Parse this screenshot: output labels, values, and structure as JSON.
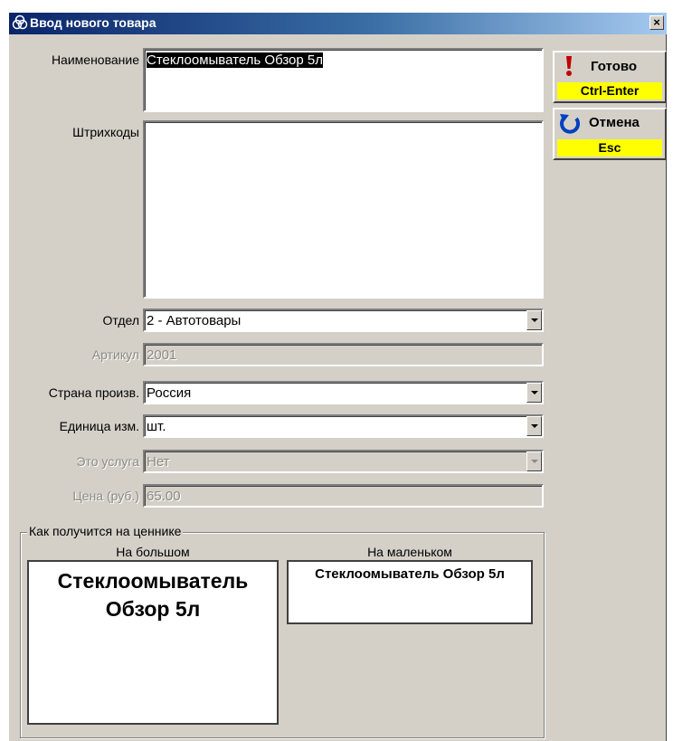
{
  "window": {
    "title": "Ввод нового товара",
    "close_glyph": "×"
  },
  "form": {
    "name": {
      "label": "Наименование",
      "value": "Стеклоомыватель  Обзор 5л"
    },
    "barcodes": {
      "label": "Штрихкоды",
      "value": ""
    },
    "department": {
      "label": "Отдел",
      "value": "2 - Автотовары"
    },
    "article": {
      "label": "Артикул",
      "value": "2001",
      "disabled": true
    },
    "country": {
      "label": "Страна произв.",
      "value": "Россия"
    },
    "unit": {
      "label": "Единица изм.",
      "value": "шт."
    },
    "is_service": {
      "label": "Это услуга",
      "value": "Нет",
      "disabled": true
    },
    "price": {
      "label": "Цена (руб.)",
      "value": "65.00",
      "disabled": true
    }
  },
  "buttons": {
    "done": {
      "label": "Готово",
      "shortcut": "Ctrl-Enter",
      "icon": "exclamation-icon"
    },
    "cancel": {
      "label": "Отмена",
      "shortcut": "Esc",
      "icon": "undo-arrow-icon"
    }
  },
  "preview": {
    "group_title": "Как получится на ценнике",
    "large": {
      "label": "На большом",
      "text": "Стеклоомыватель  Обзор 5л"
    },
    "small": {
      "label": "На маленьком",
      "text": "Стеклоомыватель  Обзор 5л"
    }
  },
  "colors": {
    "titlebar_start": "#0a246a",
    "titlebar_end": "#a6caf0",
    "window_bg": "#d4d0c8",
    "shortcut_bg": "#ffff00",
    "done_icon": "#c00000",
    "cancel_icon": "#0040c0"
  }
}
